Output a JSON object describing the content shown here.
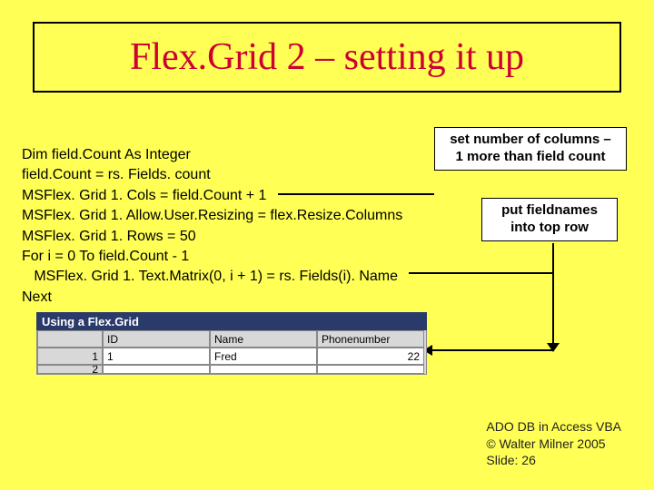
{
  "title": "Flex.Grid 2 – setting it up",
  "code": {
    "l1": "Dim field.Count As Integer",
    "l2": "field.Count = rs. Fields. count",
    "l3": "MSFlex. Grid 1. Cols = field.Count + 1",
    "l4": "MSFlex. Grid 1. Allow.User.Resizing = flex.Resize.Columns",
    "l5": "MSFlex. Grid 1. Rows = 50",
    "l6": "For i = 0 To field.Count - 1",
    "l7": "   MSFlex. Grid 1. Text.Matrix(0, i + 1) = rs. Fields(i). Name",
    "l8": "Next"
  },
  "callouts": {
    "c1_l1": "set number of columns –",
    "c1_l2": "1 more than field count",
    "c2_l1": "put fieldnames",
    "c2_l2": "into top row"
  },
  "grid": {
    "title": "Using a Flex.Grid",
    "headers": [
      "",
      "ID",
      "Name",
      "Phonenumber"
    ],
    "rows": [
      [
        "1",
        "1",
        "Fred",
        "22"
      ],
      [
        "2",
        "",
        "",
        ""
      ]
    ]
  },
  "footer": {
    "l1": "ADO DB in Access VBA",
    "l2": "© Walter Milner 2005",
    "l3": "Slide: 26"
  }
}
